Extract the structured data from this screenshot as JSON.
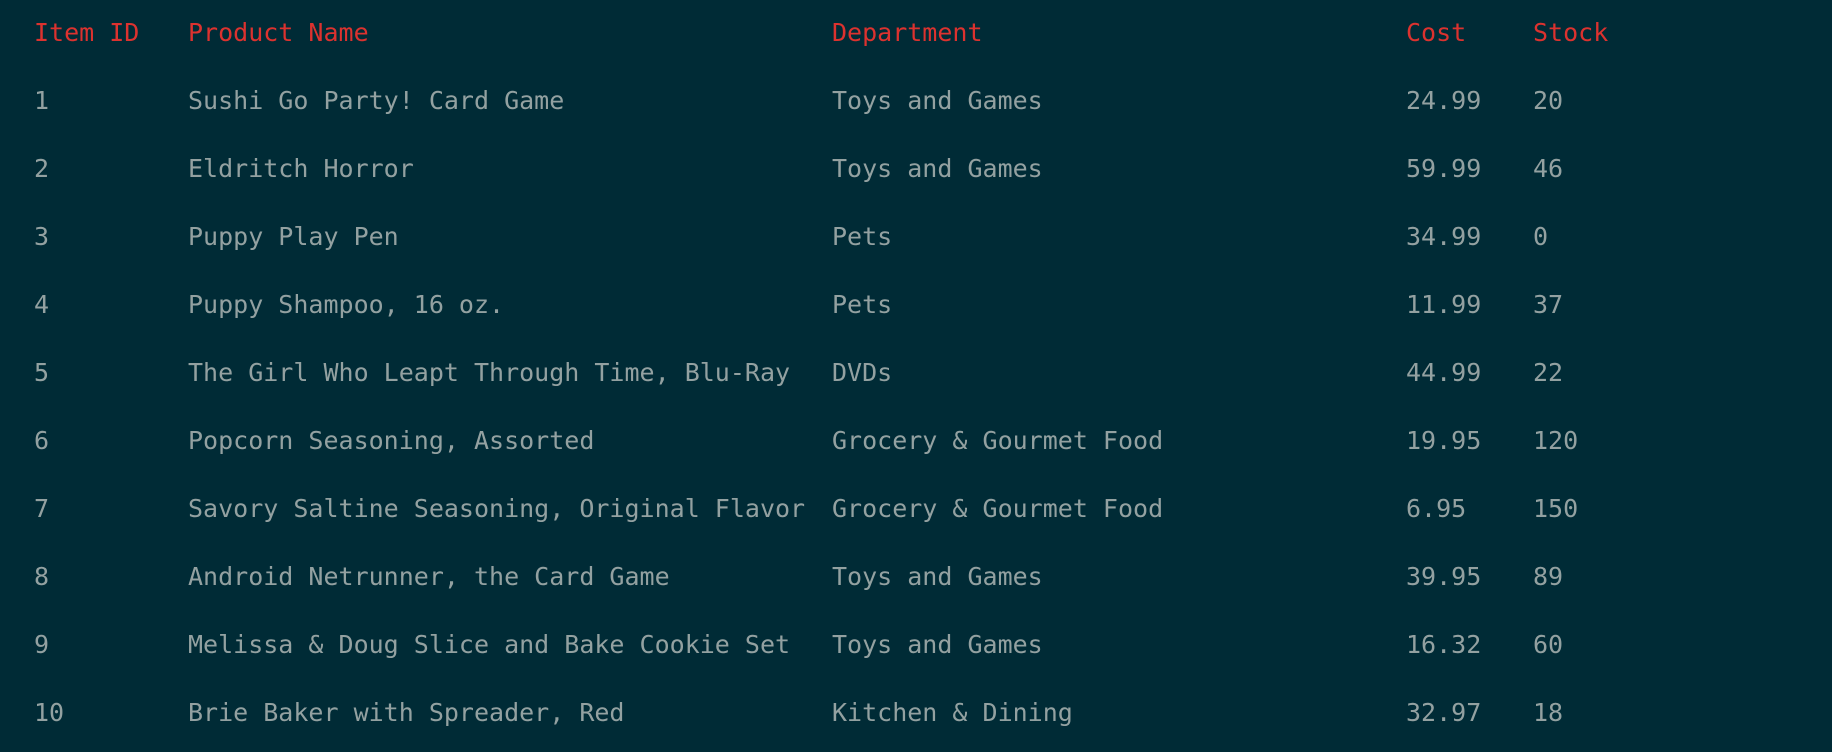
{
  "colors": {
    "background": "#002b36",
    "header_text": "#dc322f",
    "body_text": "#93a1a1"
  },
  "table": {
    "headers": [
      "Item ID",
      "Product Name",
      "Department",
      "Cost",
      "Stock"
    ],
    "rows": [
      [
        "1",
        "Sushi Go Party! Card Game",
        "Toys and Games",
        "24.99",
        "20"
      ],
      [
        "2",
        "Eldritch Horror",
        "Toys and Games",
        "59.99",
        "46"
      ],
      [
        "3",
        "Puppy Play Pen",
        "Pets",
        "34.99",
        "0"
      ],
      [
        "4",
        "Puppy Shampoo, 16 oz.",
        "Pets",
        "11.99",
        "37"
      ],
      [
        "5",
        "The Girl Who Leapt Through Time, Blu-Ray",
        "DVDs",
        "44.99",
        "22"
      ],
      [
        "6",
        "Popcorn Seasoning, Assorted",
        "Grocery & Gourmet Food",
        "19.95",
        "120"
      ],
      [
        "7",
        "Savory Saltine Seasoning, Original Flavor",
        "Grocery & Gourmet Food",
        "6.95",
        "150"
      ],
      [
        "8",
        "Android Netrunner, the Card Game",
        "Toys and Games",
        "39.95",
        "89"
      ],
      [
        "9",
        "Melissa & Doug Slice and Bake Cookie Set",
        "Toys and Games",
        "16.32",
        "60"
      ],
      [
        "10",
        "Brie Baker with Spreader, Red",
        "Kitchen & Dining",
        "32.97",
        "18"
      ]
    ]
  }
}
